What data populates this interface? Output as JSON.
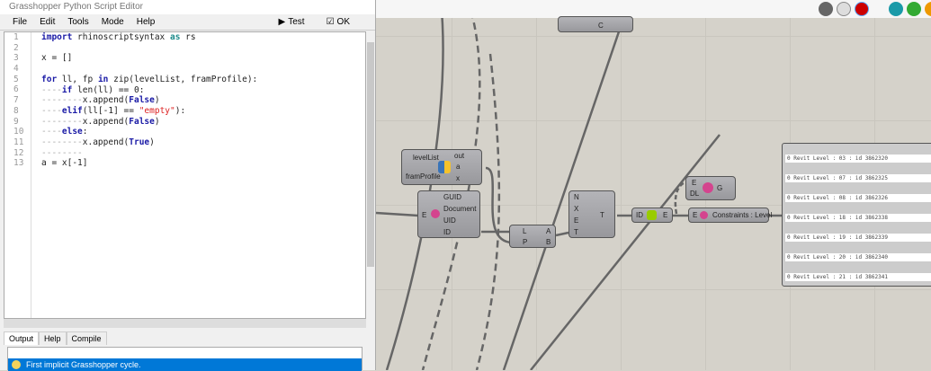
{
  "editor": {
    "title": "Grasshopper Python Script Editor",
    "menu": [
      "File",
      "Edit",
      "Tools",
      "Mode",
      "Help"
    ],
    "test_label": "Test",
    "ok_label": "OK",
    "line_numbers": [
      "1",
      "2",
      "3",
      "4",
      "5",
      "6",
      "7",
      "8",
      "9",
      "10",
      "11",
      "12",
      "13"
    ],
    "code": {
      "l1a": "import",
      "l1b": " rhinoscriptsyntax ",
      "l1c": "as",
      "l1d": " rs",
      "l3": "x = []",
      "l5a": "for",
      "l5b": " ll, fp ",
      "l5c": "in",
      "l5d": " zip(levelList, framProfile):",
      "l6a": "----",
      "l6b": "if",
      "l6c": " len(ll) == 0:",
      "l7a": "--------",
      "l7b": "x.append(",
      "l7c": "False",
      "l7d": ")",
      "l8a": "----",
      "l8b": "elif",
      "l8c": "(ll[-1] == ",
      "l8d": "\"empty\"",
      "l8e": "):",
      "l9a": "--------",
      "l9b": "x.append(",
      "l9c": "False",
      "l9d": ")",
      "l10a": "----",
      "l10b": "else",
      ":": ":",
      "l11a": "--------",
      "l11b": "x.append(",
      "l11c": "True",
      "l11d": ")",
      "l12": "--------",
      "l13": "a = x[-1]"
    },
    "output_tabs": [
      "Output",
      "Help",
      "Compile"
    ],
    "output_message": "First implicit Grasshopper cycle."
  },
  "canvas": {
    "python_comp": {
      "inputs": [
        "levelList",
        "framProfile"
      ],
      "outputs": [
        "out",
        "a",
        "x"
      ]
    },
    "element_comp": {
      "input": "E",
      "outputs": [
        "GUID",
        "Document",
        "UID",
        "ID"
      ]
    },
    "list_item": {
      "inputs": [
        "L",
        "P"
      ],
      "outputs": [
        "A",
        "B"
      ]
    },
    "filter_comp": {
      "inputs": [
        "N",
        "X",
        "E",
        "T"
      ],
      "output": "T"
    },
    "id_comp": {
      "input": "ID",
      "output": "E"
    },
    "geo_comp": {
      "inputs": [
        "E",
        "DL"
      ],
      "output": "G"
    },
    "param_comp": {
      "input": "E",
      "label": "Constraints : Level"
    },
    "top_comp": {
      "label": "C"
    },
    "panel_items": [
      "0 Revit Level : 03 : id 3862320",
      "0 Revit Level : 07 : id 3862325",
      "0 Revit Level : 08 : id 3862326",
      "0 Revit Level : 18 : id 3862338",
      "0 Revit Level : 19 : id 3862339",
      "0 Revit Level : 20 : id 3862340",
      "0 Revit Level : 21 : id 3862341"
    ]
  }
}
